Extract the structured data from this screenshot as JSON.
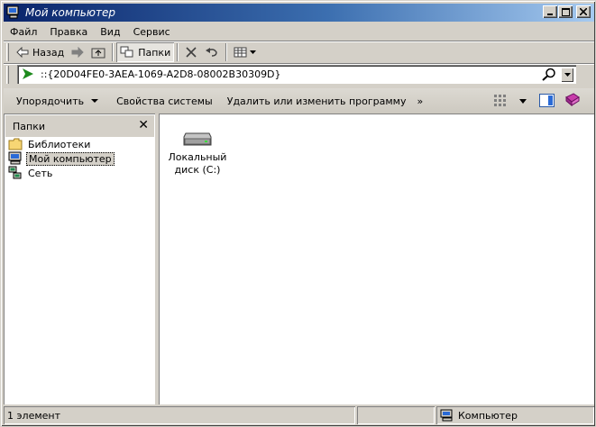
{
  "window": {
    "title": "Мой компьютер"
  },
  "menu": [
    "Файл",
    "Правка",
    "Вид",
    "Сервис"
  ],
  "toolbar": {
    "back_label": "Назад",
    "folders_label": "Папки"
  },
  "address": {
    "value": "::{20D04FE0-3AEA-1069-A2D8-08002B30309D}"
  },
  "tasks": {
    "organize_label": "Упорядочить",
    "system_properties_label": "Свойства системы",
    "uninstall_label": "Удалить или изменить программу",
    "more_label": "»"
  },
  "pane": {
    "title": "Папки",
    "close_label": "✕",
    "items": [
      {
        "label": "Библиотеки",
        "icon": "libraries-folder-icon"
      },
      {
        "label": "Мой компьютер",
        "icon": "computer-icon"
      },
      {
        "label": "Сеть",
        "icon": "network-icon"
      }
    ]
  },
  "main": {
    "items": [
      {
        "label_line1": "Локальный",
        "label_line2": "диск (C:)",
        "icon": "hard-drive-icon"
      }
    ]
  },
  "status": {
    "count": "1 элемент",
    "location": "Компьютер"
  },
  "colors": {
    "title_start": "#0a246a",
    "title_end": "#a6caf0",
    "face": "#d4d0c8"
  }
}
